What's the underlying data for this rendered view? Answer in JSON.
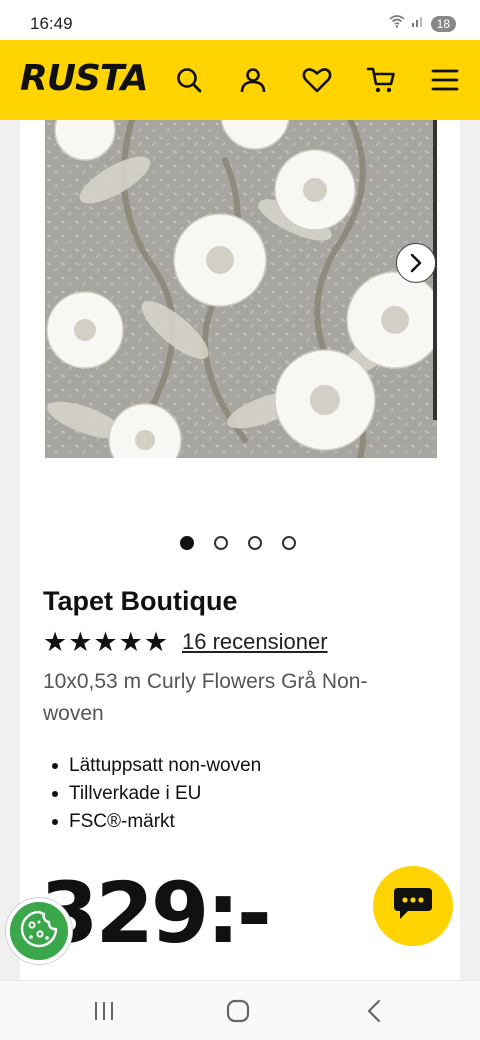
{
  "status_bar": {
    "time": "16:49",
    "battery": "18",
    "icons": [
      "wifi-icon",
      "signal-icon",
      "battery-icon"
    ]
  },
  "header": {
    "logo": "RUSTA",
    "background_color": "#ffd400",
    "icons": [
      "search-icon",
      "account-icon",
      "heart-icon",
      "cart-icon",
      "menu-icon"
    ]
  },
  "gallery": {
    "image_alt": "Curly Flowers wallpaper pattern",
    "next_icon": "chevron-right-icon",
    "slide_count": 4,
    "active_slide": 1
  },
  "product": {
    "title": "Tapet Boutique",
    "rating": 5,
    "stars": "★★★★★",
    "reviews": "16 recensioner",
    "subtitle": "10x0,53 m Curly Flowers Grå Non-woven",
    "features": [
      "Lättuppsatt non-woven",
      "Tillverkade i EU",
      "FSC®-märkt"
    ],
    "price": "329:-"
  },
  "floating": {
    "cookie_icon": "cookie-icon",
    "chat_icon": "chat-icon",
    "cookie_color": "#3aa84a",
    "chat_color": "#ffd400"
  },
  "nav_bar": {
    "icons": [
      "recent-apps-icon",
      "home-icon",
      "back-icon"
    ]
  }
}
